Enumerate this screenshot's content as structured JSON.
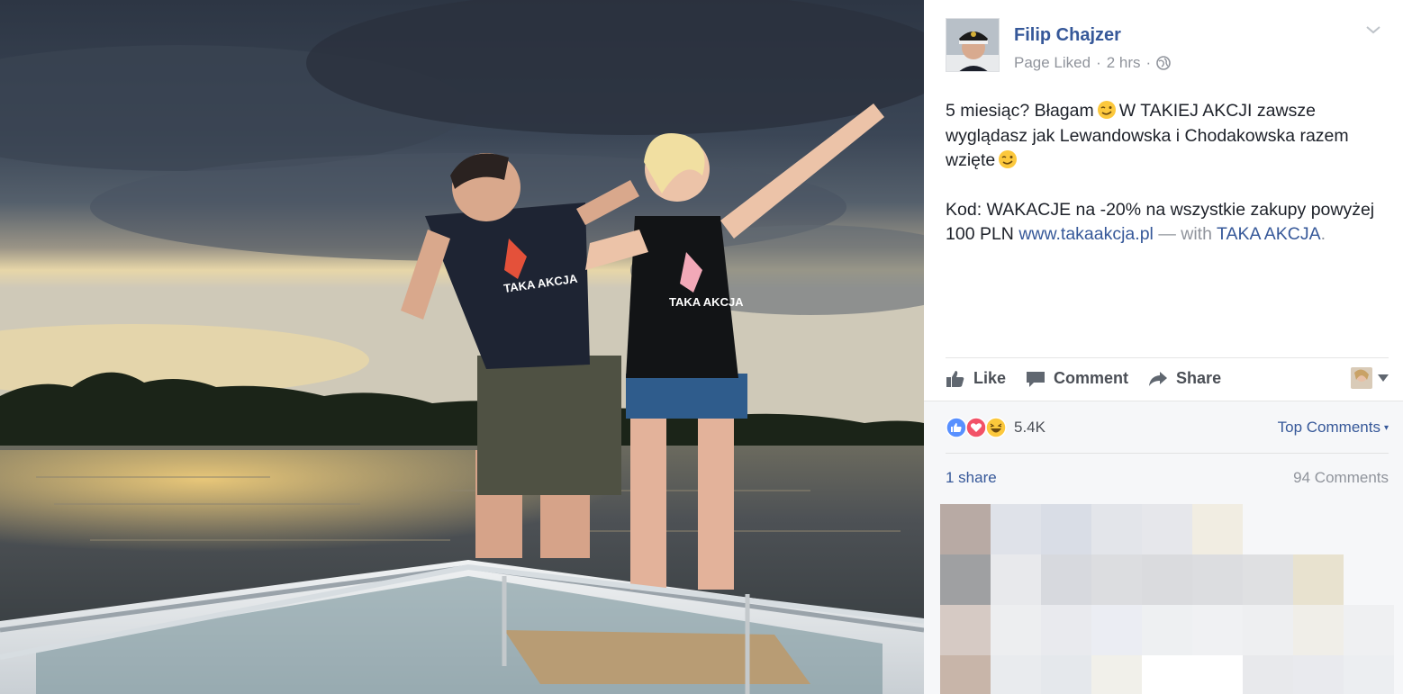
{
  "post": {
    "author": "Filip Chajzer",
    "status": "Page Liked",
    "separator": "·",
    "time": "2 hrs",
    "text": {
      "line1_a": "5 miesiąc? Błagam",
      "line1_b": "W TAKIEJ AKCJI zawsze wyglądasz jak Lewandowska i Chodakowska razem wzięte",
      "line2": "Kod: WAKACJE na -20% na wszystkie zakupy powyżej 100 PLN",
      "link": "www.takaakcja.pl",
      "with": "— with",
      "tagged": "TAKA AKCJA",
      "period": "."
    },
    "shirt_text": "TAKA AKCJA",
    "icons": [
      "globe-icon",
      "chevron-down-icon",
      "wink-emoji-icon"
    ]
  },
  "actions": {
    "like": "Like",
    "comment": "Comment",
    "share": "Share"
  },
  "feedback": {
    "reaction_count": "5.4K",
    "top_comments": "Top Comments",
    "caret": "▾",
    "shares": "1 share",
    "comments": "94 Comments",
    "reactions": [
      "like",
      "love",
      "haha"
    ]
  },
  "colors": {
    "link": "#365899",
    "muted": "#90949c",
    "text": "#1d2129",
    "like_blue": "#5890ff",
    "love_red": "#f25268",
    "haha_yellow": "#fcc83c"
  }
}
